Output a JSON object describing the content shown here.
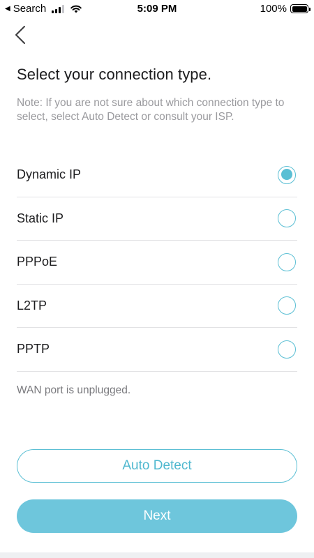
{
  "status_bar": {
    "back_app": "Search",
    "time": "5:09 PM",
    "battery": "100%",
    "battery_level": 1.0,
    "signal_bars_filled": 3,
    "signal_bars_total": 4
  },
  "header": {
    "back_icon": "chevron-left-icon"
  },
  "main": {
    "title": "Select your connection type.",
    "note": "Note: If you are not sure about which connection type to select, select Auto Detect or consult your ISP.",
    "options": [
      {
        "label": "Dynamic IP",
        "selected": true
      },
      {
        "label": "Static IP",
        "selected": false
      },
      {
        "label": "PPPoE",
        "selected": false
      },
      {
        "label": "L2TP",
        "selected": false
      },
      {
        "label": "PPTP",
        "selected": false
      }
    ],
    "wan_status": "WAN port is unplugged."
  },
  "actions": {
    "auto_detect_label": "Auto Detect",
    "next_label": "Next"
  },
  "colors": {
    "accent": "#5bbfd4",
    "next_button": "#6ec6dc",
    "note_text": "#9a9a9e"
  }
}
